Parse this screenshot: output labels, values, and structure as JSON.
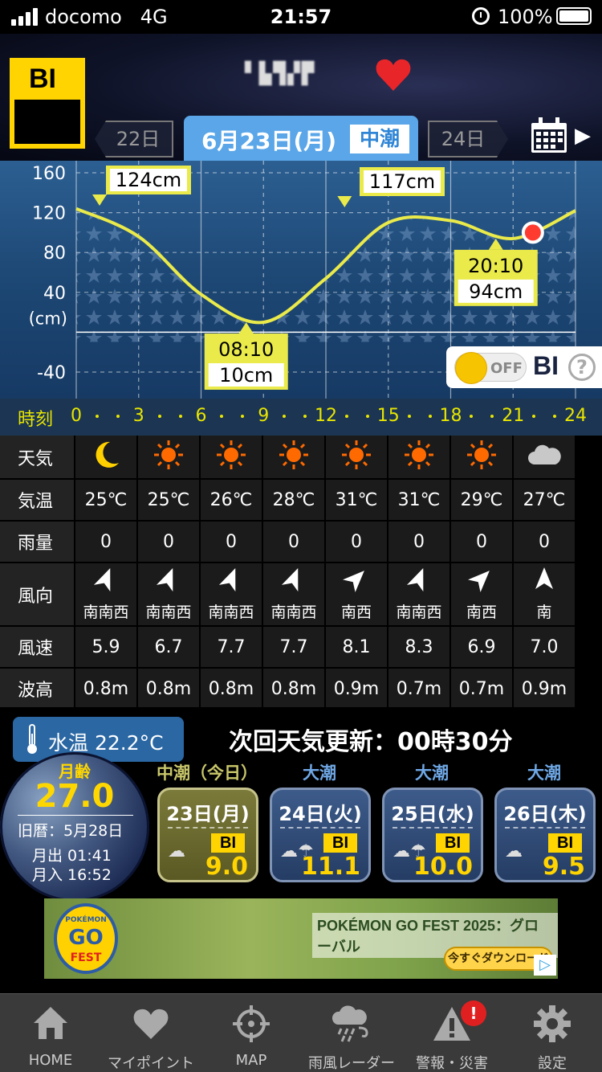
{
  "status_bar": {
    "carrier": "docomo",
    "network": "4G",
    "time": "21:57",
    "battery": "100%"
  },
  "header": {
    "logo_text": "BI",
    "spot_title": "▘▙▜▞▛",
    "prev_day": "22日",
    "current_date": "6月23日(月)",
    "current_tide": "中潮",
    "next_day": "24日"
  },
  "chart_data": {
    "type": "line",
    "x": [
      0,
      3,
      6,
      9,
      12,
      15,
      18,
      21,
      24
    ],
    "values": [
      124,
      96,
      38,
      10,
      54,
      110,
      112,
      94,
      122
    ],
    "ylabel": "(cm)",
    "yticks": [
      "160",
      "120",
      "80",
      "40",
      "-40"
    ],
    "ylim": [
      -40,
      160
    ],
    "xlim": [
      0,
      24
    ],
    "annotations": [
      {
        "time": "",
        "height": "124cm"
      },
      {
        "time": "08:10",
        "height": "10cm"
      },
      {
        "time": "",
        "height": "117cm"
      },
      {
        "time": "20:10",
        "height": "94cm"
      }
    ],
    "current_time": 21.95,
    "colors": {
      "line": "#eaea4a",
      "current": "#ff3b30",
      "grid": "#ffffff"
    }
  },
  "bi_toggle": {
    "state": "OFF",
    "label": "BI",
    "help": "?"
  },
  "time_row": {
    "label": "時刻",
    "ticks": [
      "0",
      "3",
      "6",
      "9",
      "12",
      "15",
      "18",
      "21",
      "24"
    ]
  },
  "weather": {
    "labels": {
      "weather": "天気",
      "temp": "気温",
      "rain": "雨量",
      "wind_dir": "風向",
      "wind_speed": "風速",
      "wave": "波高"
    },
    "icons": [
      "moon-icon",
      "sun-icon",
      "sun-icon",
      "sun-icon",
      "sun-icon",
      "sun-icon",
      "sun-icon",
      "cloud-icon"
    ],
    "temp": [
      "25℃",
      "25℃",
      "26℃",
      "28℃",
      "31℃",
      "31℃",
      "29℃",
      "27℃"
    ],
    "rain": [
      "0",
      "0",
      "0",
      "0",
      "0",
      "0",
      "0",
      "0"
    ],
    "wind_dir": [
      "南南西",
      "南南西",
      "南南西",
      "南南西",
      "南西",
      "南南西",
      "南西",
      "南"
    ],
    "wind_speed": [
      "5.9",
      "6.7",
      "7.7",
      "7.7",
      "8.1",
      "8.3",
      "6.9",
      "7.0"
    ],
    "wave": [
      "0.8m",
      "0.8m",
      "0.8m",
      "0.8m",
      "0.9m",
      "0.7m",
      "0.7m",
      "0.9m"
    ]
  },
  "water_temp": "水温 22.2°C",
  "next_update": "次回天気更新：00時30分",
  "moon": {
    "label": "月齢",
    "age": "27.0",
    "old_calendar": "旧暦：5月28日",
    "moonrise": "月出 01:41",
    "moonset": "月入 16:52"
  },
  "days": [
    {
      "tide": "中潮（今日）",
      "date": "23日(月)",
      "bi_label": "BI",
      "bi": "9.0",
      "weather": "☁",
      "today": true
    },
    {
      "tide": "大潮",
      "date": "24日(火)",
      "bi_label": "BI",
      "bi": "11.1",
      "weather": "☁☂",
      "today": false
    },
    {
      "tide": "大潮",
      "date": "25日(水)",
      "bi_label": "BI",
      "bi": "10.0",
      "weather": "☁☂",
      "today": false
    },
    {
      "tide": "大潮",
      "date": "26日(木)",
      "bi_label": "BI",
      "bi": "9.5",
      "weather": "☁",
      "today": false
    }
  ],
  "ad": {
    "logo_top": "POKÉMON",
    "logo_mid": "GO",
    "logo_bottom": "FEST",
    "title": "POKÉMON GO FEST 2025：グローバル",
    "button": "今すぐダウンロード",
    "choice": "▷"
  },
  "nav": [
    {
      "label": "HOME",
      "icon": "home-icon"
    },
    {
      "label": "マイポイント",
      "icon": "heart-icon"
    },
    {
      "label": "MAP",
      "icon": "crosshair-icon"
    },
    {
      "label": "雨風レーダー",
      "icon": "rain-wind-icon"
    },
    {
      "label": "警報・災害",
      "icon": "warning-icon",
      "badge": "!"
    },
    {
      "label": "設定",
      "icon": "gear-icon"
    }
  ]
}
